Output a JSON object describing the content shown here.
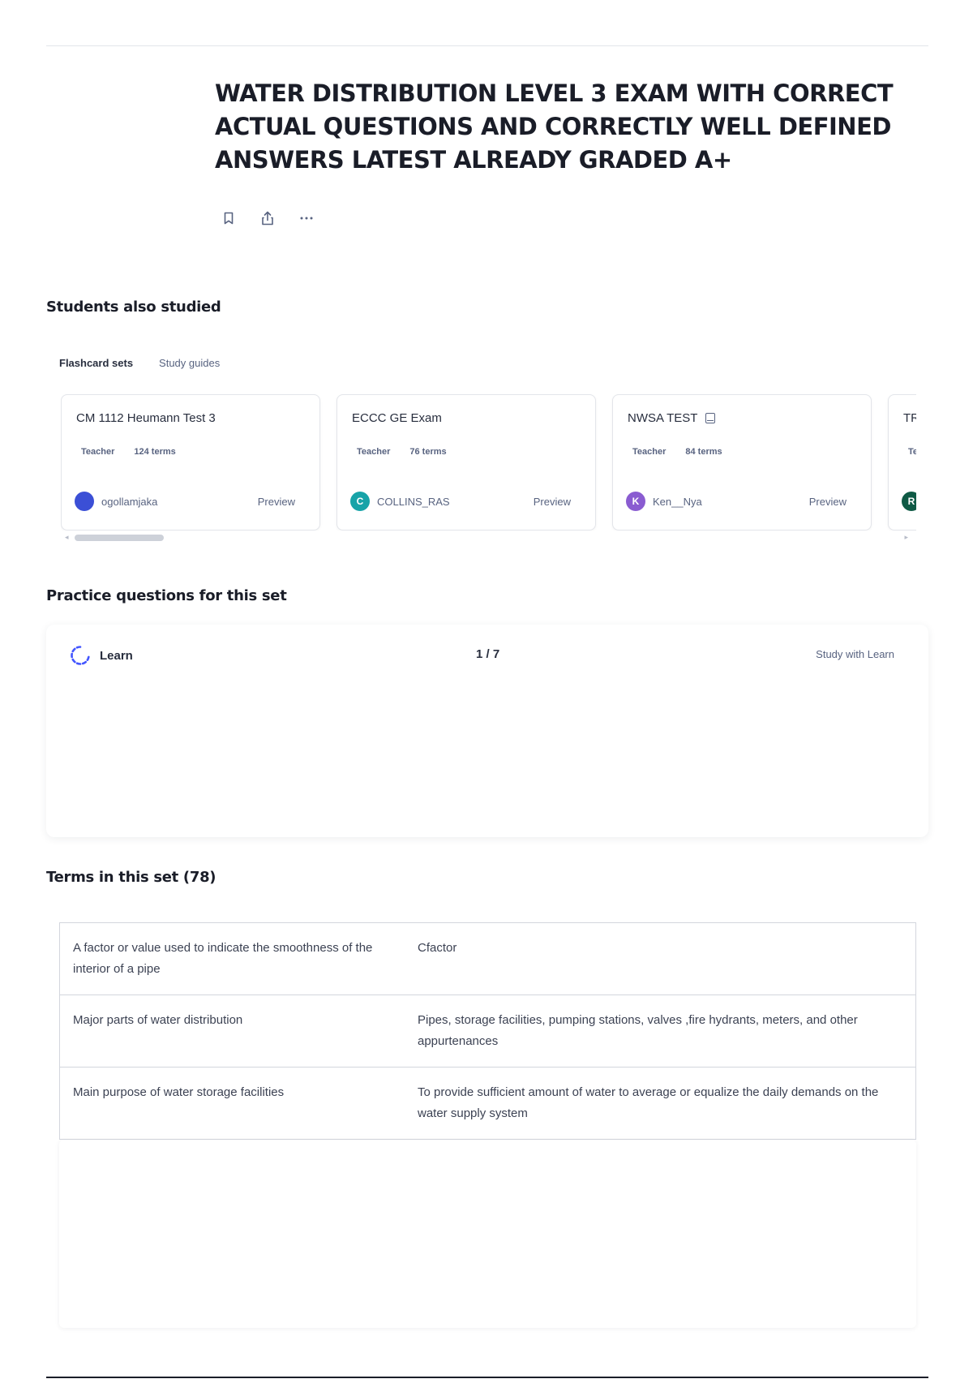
{
  "page": {
    "title": "WATER DISTRIBUTION LEVEL 3 EXAM WITH CORRECT ACTUAL QUESTIONS AND CORRECTLY WELL DEFINED ANSWERS LATEST ALREADY GRADED A+",
    "actions": [
      "bookmark-icon",
      "share-icon",
      "more-icon"
    ]
  },
  "students_also_studied": {
    "heading": "Students also studied",
    "tabs": [
      "Flashcard sets",
      "Study guides"
    ],
    "cards": [
      {
        "title": "CM 1112 Heumann Test 3",
        "role": "Teacher",
        "terms": "124 terms",
        "user": "ogollamjaka",
        "avatar_letter": "",
        "avatar_color": "#3b4fd6",
        "preview": "Preview"
      },
      {
        "title": "ECCC GE Exam",
        "role": "Teacher",
        "terms": "76 terms",
        "user": "COLLINS_RAS",
        "avatar_letter": "C",
        "avatar_color": "#17a3a8",
        "preview": "Preview"
      },
      {
        "title": "NWSA TEST",
        "role": "Teacher",
        "terms": "84 terms",
        "user": "Ken__Nya",
        "avatar_letter": "K",
        "avatar_color": "#8a5cd1",
        "preview": "Preview"
      },
      {
        "title": "TR",
        "role": "Te",
        "terms": "",
        "user": "",
        "avatar_letter": "R",
        "avatar_color": "#0f5a45",
        "preview": ""
      }
    ]
  },
  "practice": {
    "heading": "Practice questions for this set",
    "mode": "Learn",
    "counter": "1 / 7",
    "cta": "Study with Learn"
  },
  "terms": {
    "heading": "Terms in this set (78)",
    "rows": [
      {
        "term": "A factor or value used to indicate the smoothness of the interior of a pipe",
        "definition": "Cfactor"
      },
      {
        "term": "Major parts of water distribution",
        "definition": "Pipes, storage facilities, pumping stations, valves ,fire hydrants, meters, and other appurtenances"
      },
      {
        "term": "Main purpose of water storage facilities",
        "definition": "To provide sufficient amount of water to average or equalize the daily demands on the water supply system"
      }
    ]
  },
  "colors": {
    "accent": "#4255ff",
    "text": "#282e3e",
    "muted": "#586380"
  }
}
